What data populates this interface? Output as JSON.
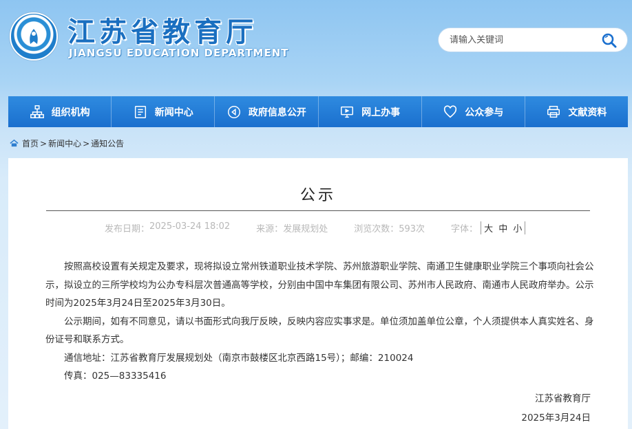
{
  "header": {
    "title": "江苏省教育厅",
    "subtitle": "JIANGSU EDUCATION DEPARTMENT",
    "search_placeholder": "请输入关键词"
  },
  "nav": {
    "items": [
      {
        "label": "组织机构",
        "icon": "org-chart-icon"
      },
      {
        "label": "新闻中心",
        "icon": "document-icon"
      },
      {
        "label": "政府信息公开",
        "icon": "play-circle-icon"
      },
      {
        "label": "网上办事",
        "icon": "monitor-icon"
      },
      {
        "label": "公众参与",
        "icon": "heart-icon"
      },
      {
        "label": "文献资料",
        "icon": "printer-icon"
      }
    ]
  },
  "breadcrumb": {
    "home": "首页",
    "sep1": ">",
    "news": "新闻中心",
    "sep2": ">",
    "current": "通知公告"
  },
  "article": {
    "title": "公示",
    "meta": {
      "date_label": "发布日期：",
      "date_value": "2025-03-24 18:02",
      "source_label": "来源：",
      "source_value": "发展规划处",
      "views_label": "浏览次数：",
      "views_value": "593次",
      "font_label": "字体：",
      "font_large": "大",
      "font_medium": "中",
      "font_small": "小"
    },
    "paragraphs": [
      "按照高校设置有关规定及要求，现将拟设立常州铁道职业技术学院、苏州旅游职业学院、南通卫生健康职业学院三个事项向社会公示，拟设立的三所学校均为公办专科层次普通高等学校，分别由中国中车集团有限公司、苏州市人民政府、南通市人民政府举办。公示时间为2025年3月24日至2025年3月30日。",
      "公示期间，如有不同意见，请以书面形式向我厅反映，反映内容应实事求是。单位须加盖单位公章，个人须提供本人真实姓名、身份证号和联系方式。",
      "通信地址：江苏省教育厅发展规划处（南京市鼓楼区北京西路15号）；邮编：210024",
      "传真：025—83335416"
    ],
    "signature": "江苏省教育厅",
    "sign_date": "2025年3月24日"
  },
  "colors": {
    "nav_bg": "#1f78d4",
    "title_blue": "#1a6fc0"
  }
}
